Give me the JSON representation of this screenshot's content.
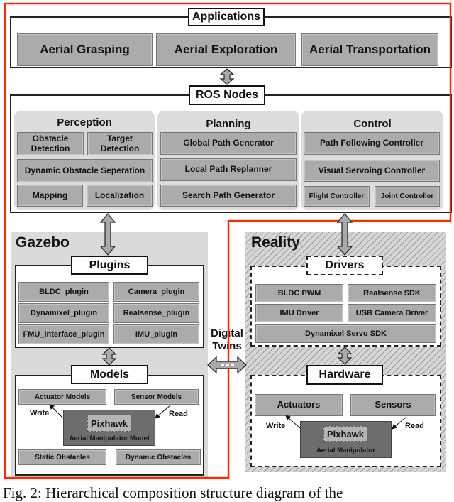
{
  "applications": {
    "title": "Applications",
    "items": [
      "Aerial Grasping",
      "Aerial Exploration",
      "Aerial Transportation"
    ]
  },
  "ros_nodes": {
    "title": "ROS Nodes",
    "perception": {
      "title": "Perception",
      "items": [
        "Obstacle Detection",
        "Target Detection",
        "Dynamic Obstacle Seperation",
        "Mapping",
        "Localization"
      ]
    },
    "planning": {
      "title": "Planning",
      "items": [
        "Global Path Generator",
        "Local Path Replanner",
        "Search Path Generator"
      ]
    },
    "control": {
      "title": "Control",
      "items": [
        "Path Following Controller",
        "Visual Servoing Controller",
        "Flight Controller",
        "Joint Controller"
      ]
    }
  },
  "gazebo": {
    "title": "Gazebo",
    "plugins": {
      "title": "Plugins",
      "items": [
        "BLDC_plugin",
        "Camera_plugin",
        "Dynamixel_plugin",
        "Realsense_plugin",
        "FMU_interface_plugin",
        "IMU_plugin"
      ]
    },
    "models": {
      "title": "Models",
      "actuator": "Actuator Models",
      "sensor": "Sensor Models",
      "write": "Write",
      "read": "Read",
      "pixhawk": "Pixhawk",
      "core": "Aerial Manipulator Model",
      "static": "Static Obstacles",
      "dynamic": "Dynamic Obstacles"
    }
  },
  "reality": {
    "title": "Reality",
    "drivers": {
      "title": "Drivers",
      "items": [
        "BLDC PWM",
        "Realsense SDK",
        "IMU Driver",
        "USB Camera Driver",
        "Dynamixel Servo SDK"
      ]
    },
    "hardware": {
      "title": "Hardware",
      "actuators": "Actuators",
      "sensors": "Sensors",
      "write": "Write",
      "read": "Read",
      "pixhawk": "Pixhawk",
      "core": "Aerial Manipulator"
    }
  },
  "digital_twins": {
    "line1": "Digital",
    "line2": "Twins"
  },
  "caption": "Fig. 2: Hierarchical composition structure diagram of the",
  "colors": {
    "outline_red": "#ff2a00",
    "box_gray": "#ababab",
    "group_gray": "#dcdcdc",
    "dark_model": "#6d6d6d"
  }
}
